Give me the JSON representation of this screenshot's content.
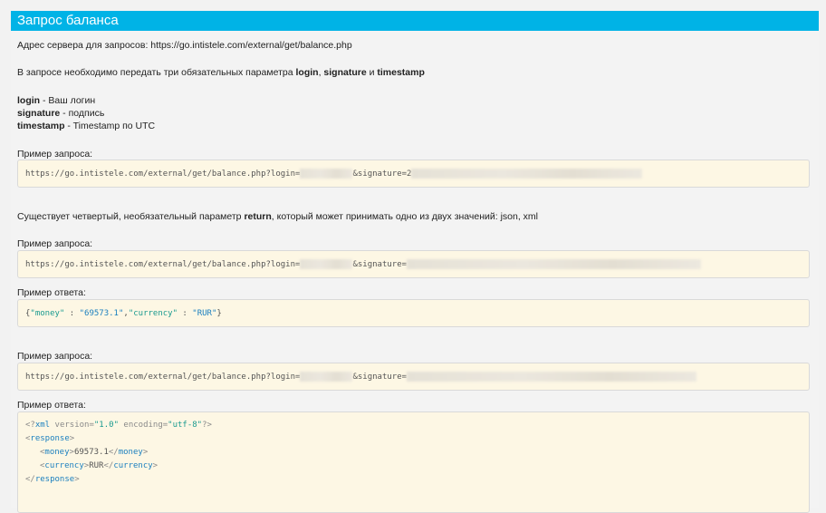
{
  "header": {
    "title": "Запрос баланса"
  },
  "intro": {
    "server_label": "Адрес сервера для запросов: https://go.intistele.com/external/get/balance.php",
    "params_prefix": "В запросе необходимо передать три обязательных параметра ",
    "p_login": "login",
    "comma": ", ",
    "p_signature": "signature",
    "and": " и ",
    "p_timestamp": "timestamp"
  },
  "params": [
    {
      "name": "login",
      "desc": " - Ваш логин"
    },
    {
      "name": "signature",
      "desc": " - подпись"
    },
    {
      "name": "timestamp",
      "desc": " - Timestamp по UTC"
    }
  ],
  "example1": {
    "label": "Пример запроса:",
    "url_start": "https://go.intistele.com/external/get/balance.php?login=",
    "url_sig": "&signature=2"
  },
  "optional": {
    "prefix": "Существует четвертый, необязательный параметр ",
    "param": "return",
    "suffix": ", который может принимать одно из двух значений: json, xml"
  },
  "example2": {
    "label": "Пример запроса:",
    "url_start": "https://go.intistele.com/external/get/balance.php?login=",
    "url_sig": "&signature=",
    "response_label": "Пример ответа:",
    "json": {
      "open": "{",
      "k1": "\"money\"",
      "sep1": " : ",
      "v1": "\"69573.1\"",
      "comma": ",",
      "k2": "\"currency\"",
      "sep2": " : ",
      "v2": "\"RUR\"",
      "close": "}"
    }
  },
  "example3": {
    "label": "Пример запроса:",
    "url_start": "https://go.intistele.com/external/get/balance.php?login=",
    "url_sig": "&signature=",
    "response_label": "Пример ответа:",
    "xml": {
      "decl_open": "<?",
      "decl_name": "xml",
      "attr1": " version=",
      "val1": "\"1.0\"",
      "attr2": " encoding=",
      "val2": "\"utf-8\"",
      "decl_close": "?>",
      "lt": "<",
      "gt": ">",
      "lt_slash": "</",
      "response": "response",
      "money": "money",
      "money_val": "69573.1",
      "currency": "currency",
      "currency_val": "RUR"
    }
  },
  "colors": {
    "header_bg": "#00b3e6",
    "code_bg": "#fdf7e4",
    "key": "#1a9a8f",
    "string": "#1a7fbf"
  }
}
